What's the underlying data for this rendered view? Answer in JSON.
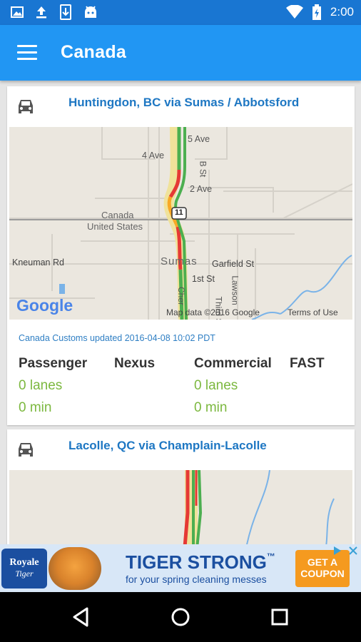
{
  "statusbar": {
    "time": "2:00"
  },
  "appbar": {
    "title": "Canada",
    "menu_icon": "hamburger-menu-icon"
  },
  "crossings": [
    {
      "title": "Huntingdon, BC via Sumas / Abbotsford",
      "updated": "Canada Customs updated 2016-04-08 10:02 PDT",
      "map": {
        "labels": [
          "5 Ave",
          "4 Ave",
          "B St",
          "2 Ave",
          "11",
          "Canada",
          "United States",
          "Kneuman Rd",
          "Sumas",
          "Garfield St",
          "1st St",
          "Lawson",
          "Cher",
          "Third S"
        ],
        "attribution": "Map data ©2016 Google",
        "terms": "Terms of Use",
        "logo": "Google"
      },
      "columns": [
        {
          "label": "Passenger",
          "lanes": "0 lanes",
          "wait": "0 min"
        },
        {
          "label": "Nexus",
          "lanes": "",
          "wait": ""
        },
        {
          "label": "Commercial",
          "lanes": "0 lanes",
          "wait": "0 min"
        },
        {
          "label": "FAST",
          "lanes": "",
          "wait": ""
        }
      ]
    },
    {
      "title": "Lacolle, QC via Champlain-Lacolle"
    }
  ],
  "ad": {
    "brand": "Royale",
    "brand_sub": "Tiger",
    "headline": "TIGER STRONG",
    "tm": "™",
    "subline": "for your spring cleaning messes",
    "cta": "GET A COUPON"
  },
  "colors": {
    "appbar": "#2196f3",
    "statusbar": "#1976d2",
    "link": "#1e77c3",
    "value": "#7cb83f"
  }
}
